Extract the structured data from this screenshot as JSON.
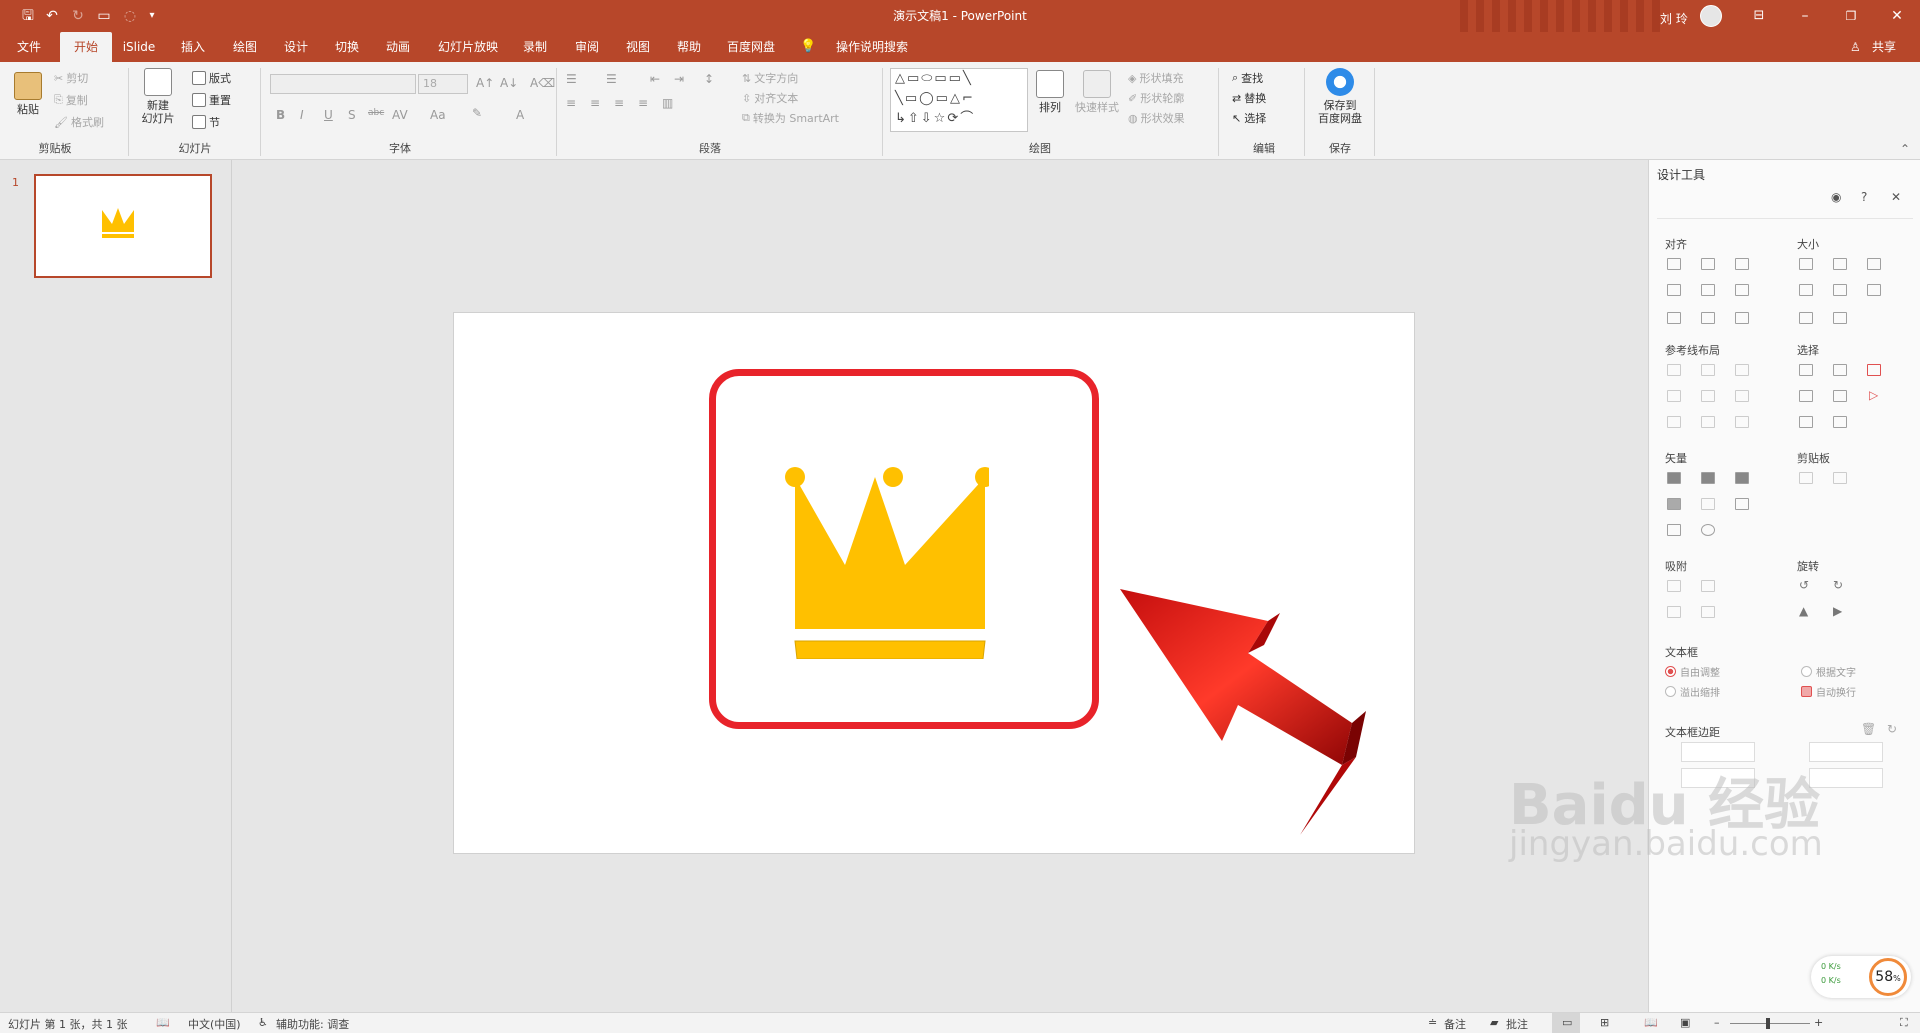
{
  "window": {
    "title": "演示文稿1 - PowerPoint",
    "user": "刘 玲"
  },
  "tabs": [
    "文件",
    "开始",
    "iSlide",
    "插入",
    "绘图",
    "设计",
    "切换",
    "动画",
    "幻灯片放映",
    "录制",
    "审阅",
    "视图",
    "帮助",
    "百度网盘"
  ],
  "active_tab": "开始",
  "tell_me": "操作说明搜索",
  "share": "共享",
  "ribbon": {
    "clipboard": {
      "paste": "粘贴",
      "cut": "剪切",
      "copy": "复制",
      "format_painter": "格式刷",
      "label": "剪贴板"
    },
    "slides": {
      "new_slide_1": "新建",
      "new_slide_2": "幻灯片",
      "layout": "版式",
      "reset": "重置",
      "section": "节",
      "label": "幻灯片"
    },
    "font": {
      "size": "18",
      "label": "字体",
      "bold": "B",
      "italic": "I",
      "underline": "U",
      "shadow": "S",
      "strike": "abc",
      "spacing": "AV",
      "case": "Aa",
      "color": "A"
    },
    "paragraph": {
      "text_direction": "文字方向",
      "align_text": "对齐文本",
      "smartart": "转换为 SmartArt",
      "label": "段落"
    },
    "drawing": {
      "arrange": "排列",
      "quick_styles": "快速样式",
      "fill": "形状填充",
      "outline": "形状轮廓",
      "effects": "形状效果",
      "label": "绘图"
    },
    "editing": {
      "find": "查找",
      "replace": "替换",
      "select": "选择",
      "label": "编辑"
    },
    "save": {
      "line1": "保存到",
      "line2": "百度网盘",
      "label": "保存"
    }
  },
  "thumbnail": {
    "number": "1"
  },
  "design_pane": {
    "title": "设计工具",
    "sections": {
      "align": "对齐",
      "size": "大小",
      "guides": "参考线布局",
      "select": "选择",
      "vector": "矢量",
      "clipboard": "剪贴板",
      "snap": "吸附",
      "rotate": "旋转",
      "textbox": "文本框",
      "margins": "文本框边距"
    },
    "textbox_options": [
      "自由调整",
      "根据文字",
      "溢出缩排",
      "自动换行"
    ]
  },
  "status": {
    "slide_info": "幻灯片 第 1 张，共 1 张",
    "language": "中文(中国)",
    "accessibility": "辅助功能: 调查",
    "notes": "备注",
    "comments": "批注"
  },
  "net": {
    "up": "0 K/s",
    "down": "0 K/s",
    "percent": "58",
    "unit": "%"
  },
  "watermark": {
    "brand": "Baidu 经验",
    "url": "jingyan.baidu.com"
  },
  "colors": {
    "accent": "#b7472a",
    "crown": "#ffc000",
    "highlight_box": "#e8232a",
    "arrow": "#e31b1b"
  }
}
